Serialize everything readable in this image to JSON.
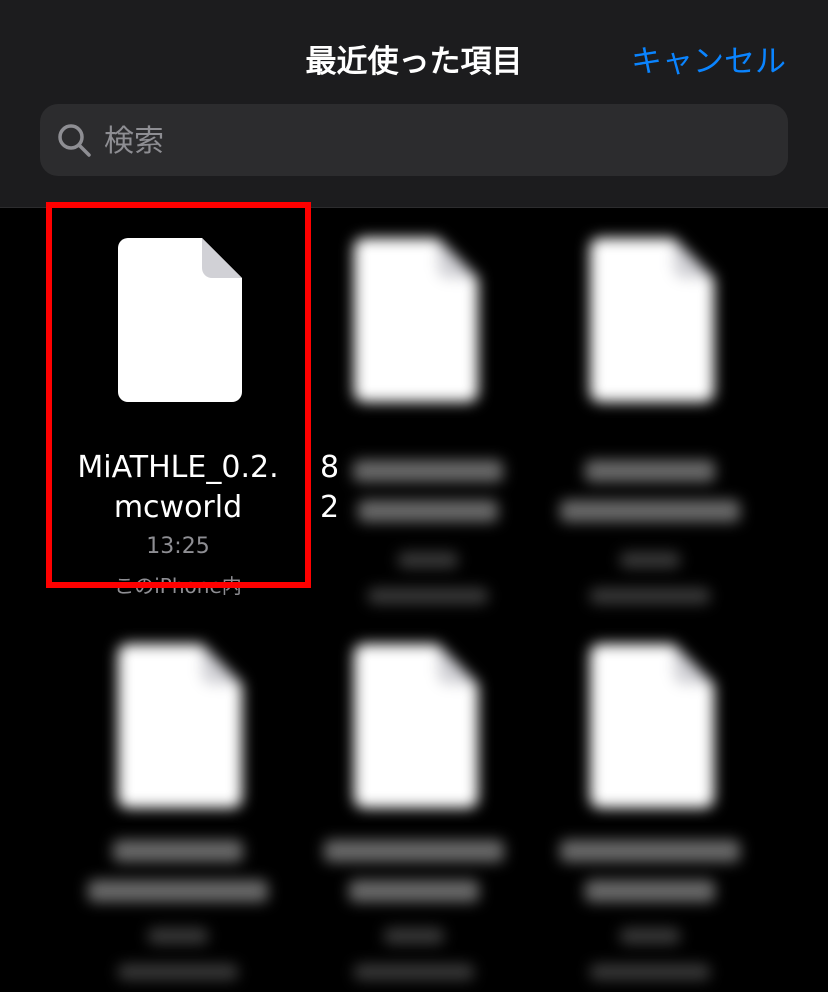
{
  "header": {
    "title": "最近使った項目",
    "cancel_label": "キャンセル"
  },
  "search": {
    "placeholder": "検索",
    "icon": "magnifying-glass"
  },
  "files": [
    {
      "name_line1": "MiATHLE_0.2.",
      "name_line2": "mcworld",
      "time": "13:25",
      "location": "このiPhone内",
      "highlighted": true
    },
    {
      "name_line1": "8",
      "name_line2": "2",
      "time": "",
      "location": "",
      "blurred": true
    },
    {
      "name_line1": "",
      "name_line2": "",
      "time": "",
      "location": "",
      "blurred": true
    },
    {
      "name_line1": "",
      "name_line2": "",
      "time": "",
      "location": "",
      "blurred": true
    },
    {
      "name_line1": "",
      "name_line2": "",
      "time": "",
      "location": "",
      "blurred": true
    },
    {
      "name_line1": "",
      "name_line2": "",
      "time": "",
      "location": "",
      "blurred": true
    }
  ],
  "colors": {
    "accent": "#0a84ff",
    "highlight_border": "#ff0000",
    "header_bg": "#1c1c1e",
    "background": "#000000"
  }
}
